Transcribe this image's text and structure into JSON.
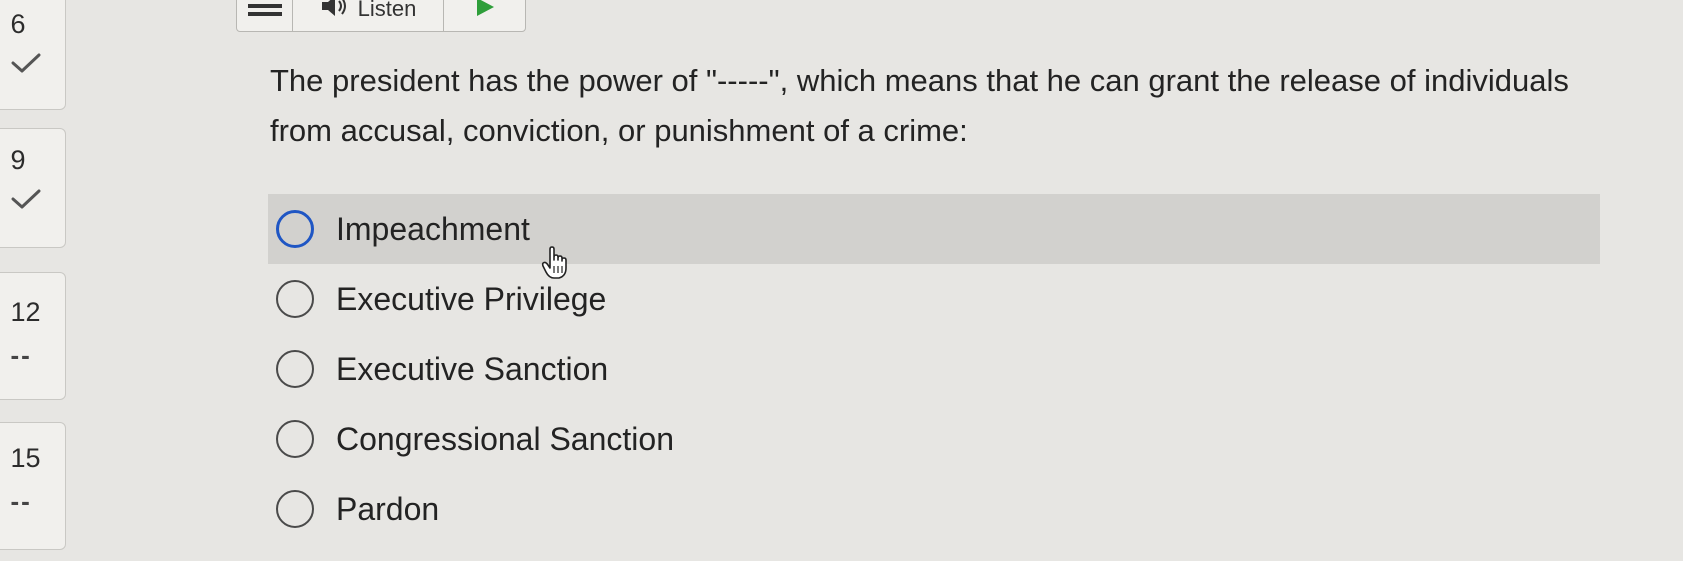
{
  "navigator": {
    "items": [
      {
        "number": "6",
        "status": "answered"
      },
      {
        "number": "9",
        "status": "answered"
      },
      {
        "number": "12",
        "status_text": "--"
      },
      {
        "number": "15",
        "status_text": "--"
      }
    ]
  },
  "toolbar": {
    "listen_label": "Listen"
  },
  "question": {
    "text": "The president has the power of \"-----\", which means that he can grant the release of individuals from accusal, conviction, or punishment of a crime:"
  },
  "choices": [
    {
      "label": "Impeachment",
      "hovered": true
    },
    {
      "label": "Executive Privilege"
    },
    {
      "label": "Executive Sanction"
    },
    {
      "label": "Congressional Sanction"
    },
    {
      "label": "Pardon"
    }
  ],
  "colors": {
    "background": "#e7e6e3",
    "hover_row": "#d2d1ce",
    "radio_hover": "#1f56c4",
    "play_icon": "#2e9e3a"
  }
}
